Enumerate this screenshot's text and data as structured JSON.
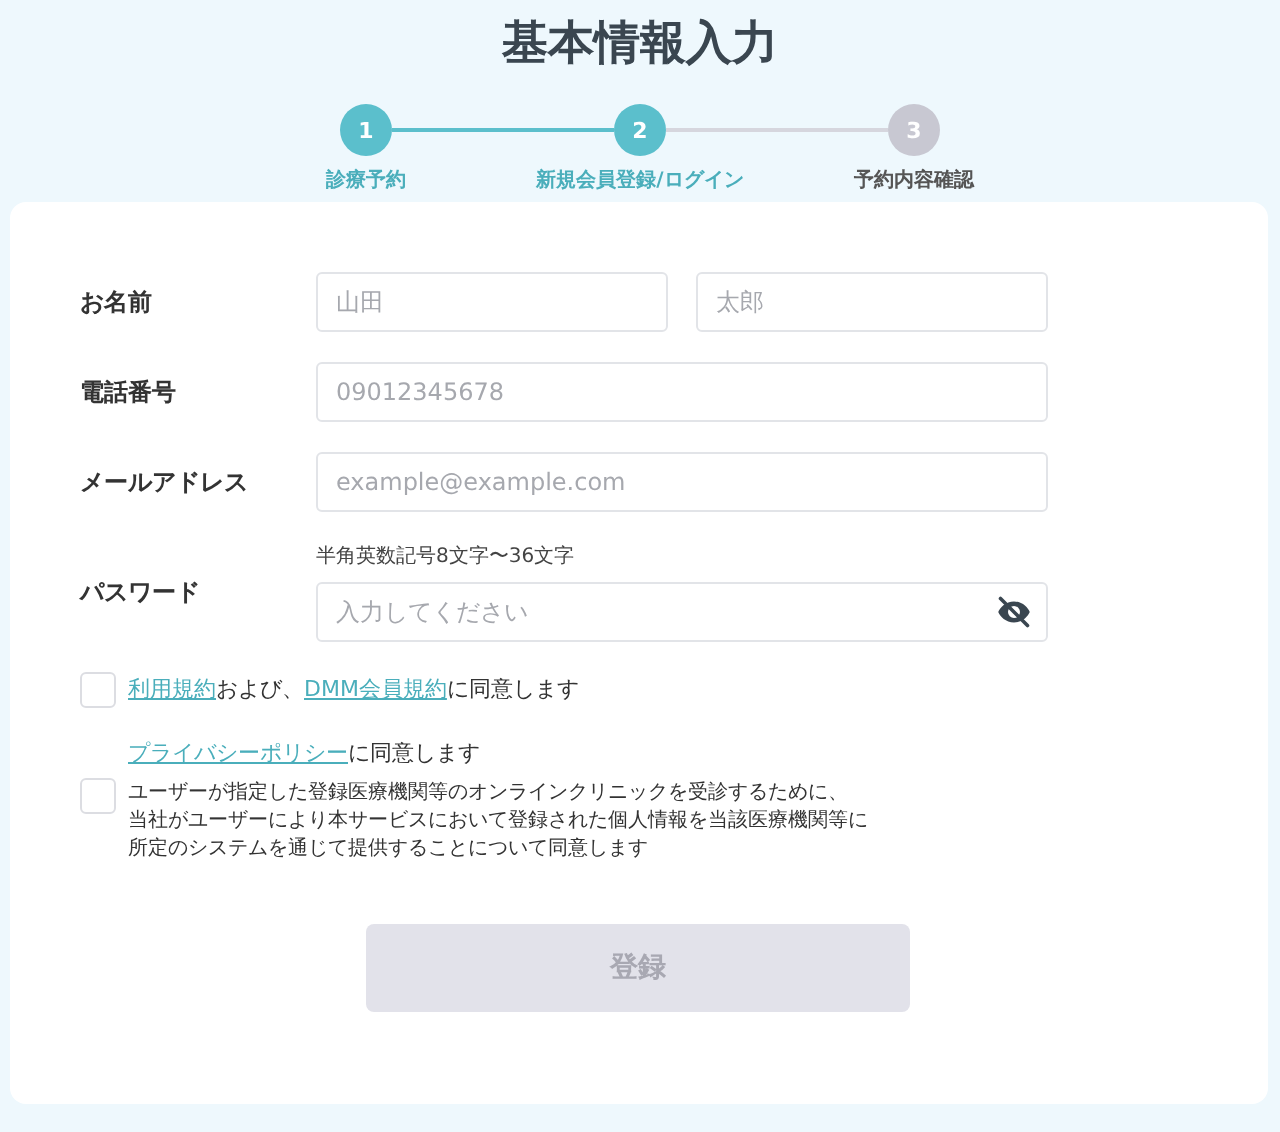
{
  "title": "基本情報入力",
  "steps": [
    {
      "number": "1",
      "label": "診療予約",
      "completed": true
    },
    {
      "number": "2",
      "label": "新規会員登録/ログイン",
      "completed": true
    },
    {
      "number": "3",
      "label": "予約内容確認",
      "completed": false
    }
  ],
  "fields": [
    {
      "label": "お名前",
      "kind": "name",
      "inputs": [
        {
          "placeholder": "山田"
        },
        {
          "placeholder": "太郎"
        }
      ]
    },
    {
      "label": "電話番号",
      "kind": "text",
      "inputs": [
        {
          "placeholder": "09012345678"
        }
      ]
    },
    {
      "label": "メールアドレス",
      "kind": "text",
      "inputs": [
        {
          "placeholder": "example@example.com"
        }
      ]
    },
    {
      "label": "パスワード",
      "kind": "password",
      "hint": "半角英数記号8文字〜36文字",
      "inputs": [
        {
          "placeholder": "入力してください"
        }
      ]
    }
  ],
  "agreements": [
    {
      "checked": false,
      "heading": [
        {
          "text": "利用規約",
          "link": true
        },
        {
          "text": "および、",
          "link": false
        },
        {
          "text": "DMM会員規約",
          "link": true
        },
        {
          "text": "に同意します",
          "link": false
        }
      ]
    },
    {
      "checked": false,
      "heading": [
        {
          "text": "プライバシーポリシー",
          "link": true
        },
        {
          "text": "に同意します",
          "link": false
        }
      ],
      "detail": [
        "ユーザーが指定した登録医療機関等のオンラインクリニックを受診するために、",
        "当社がユーザーにより本サービスにおいて登録された個人情報を当該医療機関等に",
        "所定のシステムを通じて提供することについて同意します"
      ]
    }
  ],
  "submit": {
    "label": "登録",
    "disabled": true
  }
}
